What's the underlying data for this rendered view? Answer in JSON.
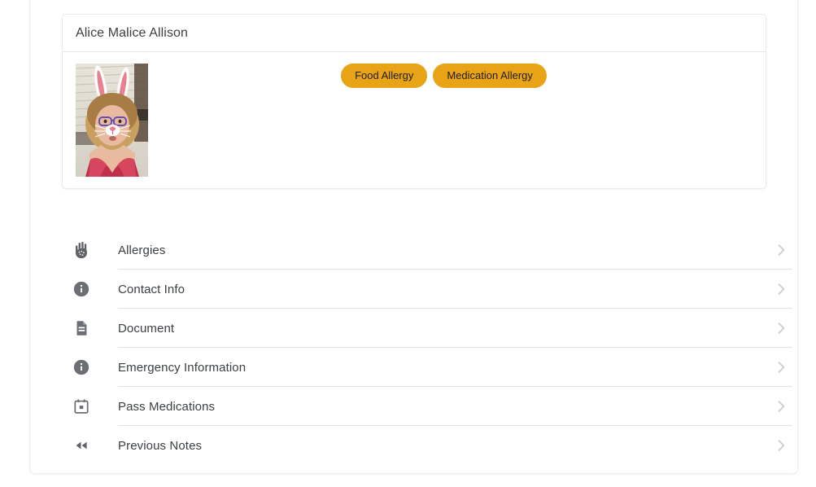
{
  "patient_card": {
    "name": "Alice Malice Allison",
    "photo_alt": "patient-photo",
    "badges": [
      {
        "label": "Food Allergy",
        "color": "#e8a317"
      },
      {
        "label": "Medication Allergy",
        "color": "#e8a317"
      }
    ]
  },
  "nav_list": {
    "items": [
      {
        "label": "Allergies",
        "icon": "hand-allergy-icon",
        "chevron": "chevron-right-icon"
      },
      {
        "label": "Contact Info",
        "icon": "info-circle-icon",
        "chevron": "chevron-right-icon"
      },
      {
        "label": "Document",
        "icon": "document-icon",
        "chevron": "chevron-right-icon"
      },
      {
        "label": "Emergency Information",
        "icon": "info-circle-icon",
        "chevron": "chevron-right-icon"
      },
      {
        "label": "Pass Medications",
        "icon": "calendar-event-icon",
        "chevron": "chevron-right-icon"
      },
      {
        "label": "Previous Notes",
        "icon": "fast-rewind-icon",
        "chevron": "chevron-right-icon"
      }
    ]
  },
  "theme": {
    "badge_color": "#e8a317",
    "text_color": "#3c4043",
    "icon_color": "#5f6368",
    "chevron_color": "#cccccc",
    "divider_color": "#e4e4e4"
  }
}
